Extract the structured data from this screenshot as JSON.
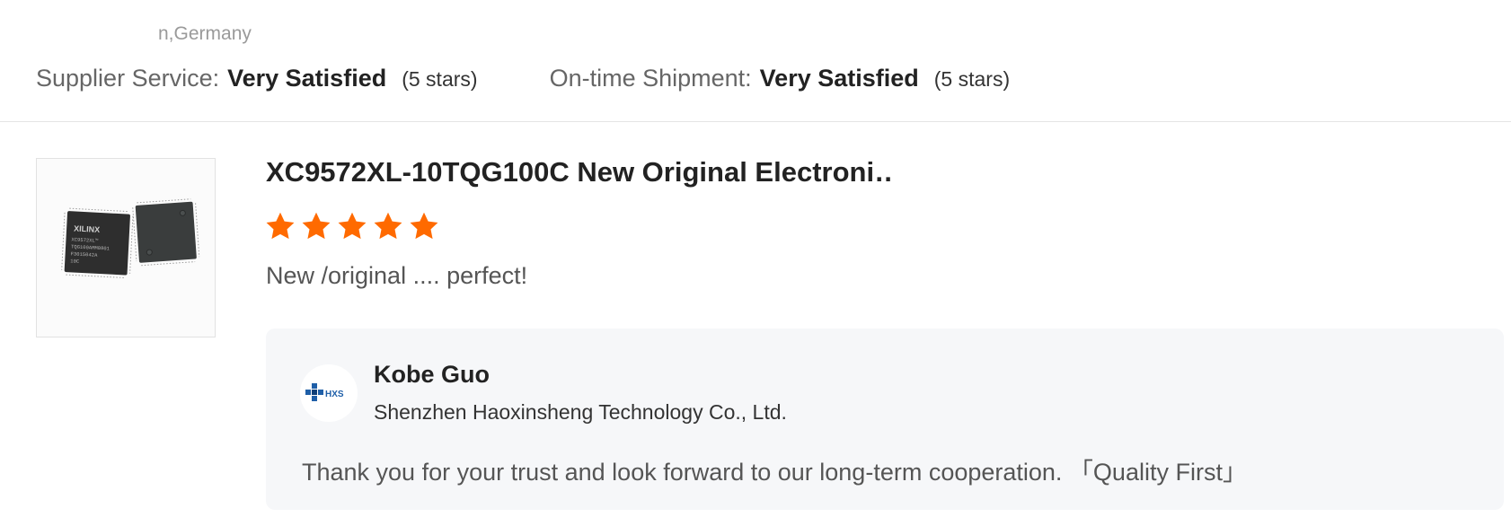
{
  "header": {
    "location": "n,Germany",
    "supplier_service": {
      "label": "Supplier Service:",
      "value": "Very Satisfied",
      "stars": "(5 stars)"
    },
    "on_time_shipment": {
      "label": "On-time Shipment:",
      "value": "Very Satisfied",
      "stars": "(5 stars)"
    }
  },
  "review": {
    "product_title": "XC9572XL-10TQG100C New Original Electroni…",
    "rating": 5,
    "rating_max": 5,
    "star_color": "#ff6a00",
    "text": "New /original .... perfect!",
    "product_image_icon": "chip-product-image",
    "chip_brand": "XILINX",
    "chip_marking_lines": [
      "XC9572XL™",
      "TQG100AMM0801",
      "F3015042A",
      "10C"
    ]
  },
  "reply": {
    "avatar_logo_text": "HXS",
    "avatar_color": "#1f5fa8",
    "name": "Kobe Guo",
    "company": "Shenzhen Haoxinsheng Technology Co., Ltd.",
    "text": "Thank you for your trust and look forward to our long-term cooperation.  「Quality First」"
  }
}
